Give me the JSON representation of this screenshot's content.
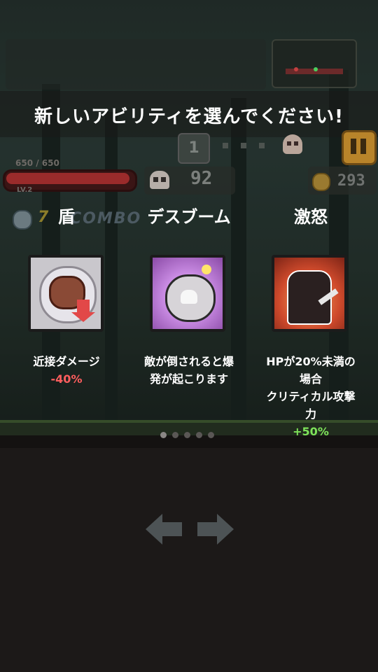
{
  "banner": {
    "title": "新しいアビリティを選んでください!"
  },
  "hud": {
    "wave": "1",
    "hp_text": "650 / 650",
    "hp_fraction": 1.0,
    "level": "LV.2",
    "kills": "92",
    "coins": "293",
    "combo_count": "7",
    "combo_label": "COMBO"
  },
  "abilities": [
    {
      "name": "盾",
      "desc_line1": "近接ダメージ",
      "desc_value": "-40%",
      "icon": "meat-shield-icon"
    },
    {
      "name": "デスブーム",
      "desc_line1": "敵が倒されると爆",
      "desc_line2": "発が起こります",
      "icon": "skull-bomb-icon"
    },
    {
      "name": "激怒",
      "desc_line1": "HPが20%未満の",
      "desc_line2": "場合",
      "desc_line3": "クリティカル攻撃",
      "desc_line4": "力",
      "desc_value": "+50%",
      "icon": "rage-silhouette-icon"
    }
  ],
  "pager": {
    "count": 5,
    "active": 0
  },
  "colors": {
    "negative": "#ff5e5e",
    "positive": "#7ee35a",
    "pause": "#b8842a"
  }
}
